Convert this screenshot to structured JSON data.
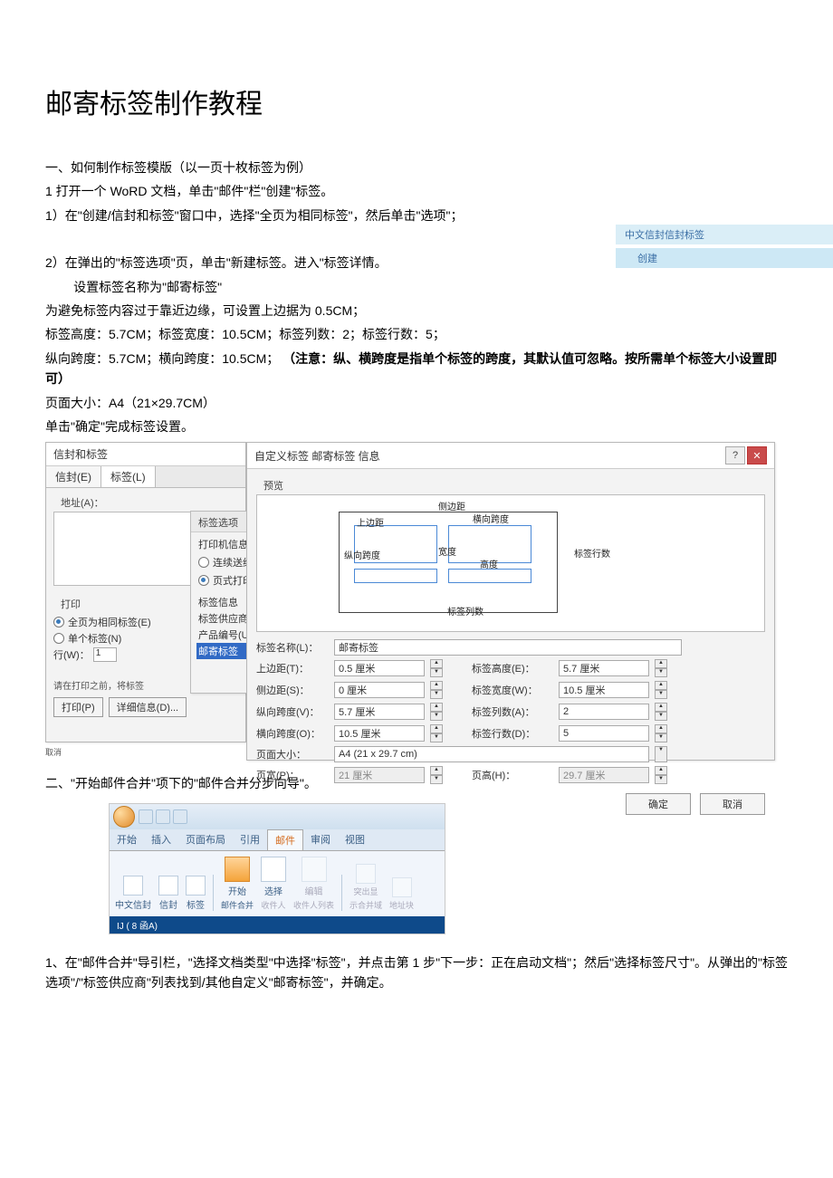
{
  "doc": {
    "title": "邮寄标签制作教程",
    "section1": "一、如何制作标签模版（以一页十枚标签为例）",
    "step1_1": "1 打开一个 WoRD 文档，单击\"邮件\"栏\"创建\"标签。",
    "step1_1a": "1）在\"创建/信封和标签\"窗口中，选择\"全页为相同标签\"，然后单击\"选项\"；",
    "step1_2": "2）在弹出的\"标签选项\"页，单击\"新建标签。进入\"标签详情。",
    "set_name": "        设置标签名称为\"邮寄标签\"",
    "avoid_edge": "为避免标签内容过于靠近边缘，可设置上边据为 0.5CM；",
    "dims1": "标签高度：5.7CM；标签宽度：10.5CM；标签列数：2；标签行数：5；",
    "dims2_a": "纵向跨度：5.7CM；横向跨度：10.5CM；",
    "dims2_b": "（注意：纵、横跨度是指单个标签的跨度，其默认值可忽略。按所需单个标签大小设置即可）",
    "page_size": "页面大小：A4（21×29.7CM）",
    "confirm": "单击\"确定\"完成标签设置。",
    "section2": "二、\"开始邮件合并\"项下的\"邮件合并分步向导\"。",
    "step2_1": "1、在\"邮件合并\"导引栏，\"选择文档类型\"中选择\"标签\"，并点击第 1 步\"下一步：正在启动文档\"；然后\"选择标签尺寸\"。从弹出的\"标签选项\"/\"标签供应商\"列表找到/其他自定义\"邮寄标签\"，并确定。"
  },
  "float": {
    "line1": "中文信封信封标签",
    "line2": "创建"
  },
  "dlg_left": {
    "title": "信封和标签",
    "tab_env": "信封(E)",
    "tab_lbl": "标签(L)",
    "address": "地址(A)：",
    "print": "打印",
    "full_page": "全页为相同标签(E)",
    "single": "单个标签(N)",
    "row": "行(W)：",
    "row_val": "1",
    "before_print": "请在打印之前，将标签",
    "btn_print": "打印(P)",
    "btn_detail": "详细信息(D)...",
    "cancel": "取消"
  },
  "dlg_mid": {
    "title": "标签选项",
    "printer_info": "打印机信息",
    "cont_feed": "连续送纸打印机",
    "page_printer": "页式打印机(A)",
    "label_info": "标签信息",
    "vendor": "标签供应商(V)：",
    "product_no": "产品编号(U)：",
    "selected": "邮寄标签"
  },
  "dlg_right": {
    "title": "自定义标签 邮寄标签 信息",
    "preview": "预览",
    "pv_sidemargin": "侧边距",
    "pv_topmargin": "上边距",
    "pv_hspan": "横向跨度",
    "pv_vspan": "纵向跨度",
    "pv_width": "宽度",
    "pv_height": "高度",
    "pv_rows": "标签行数",
    "pv_cols": "标签列数",
    "lbl_name": "标签名称(L)：",
    "val_name": "邮寄标签",
    "lbl_top": "上边距(T)：",
    "val_top": "0.5 厘米",
    "lbl_side": "侧边距(S)：",
    "val_side": "0 厘米",
    "lbl_vspan": "纵向跨度(V)：",
    "val_vspan": "5.7 厘米",
    "lbl_hspan": "横向跨度(O)：",
    "val_hspan": "10.5 厘米",
    "lbl_page": "页面大小：",
    "val_page": "A4 (21 x 29.7 cm)",
    "lbl_pwidth": "页宽(P)：",
    "val_pwidth": "21 厘米",
    "lbl_lheight": "标签高度(E)：",
    "val_lheight": "5.7 厘米",
    "lbl_lwidth": "标签宽度(W)：",
    "val_lwidth": "10.5 厘米",
    "lbl_cols": "标签列数(A)：",
    "val_cols": "2",
    "lbl_rows": "标签行数(D)：",
    "val_rows": "5",
    "lbl_pheight": "页高(H)：",
    "val_pheight": "29.7 厘米",
    "ok": "确定",
    "cancel": "取消"
  },
  "ribbon": {
    "tabs": [
      "开始",
      "插入",
      "页面布局",
      "引用",
      "邮件",
      "审阅",
      "视图"
    ],
    "env_cn": "中文信封",
    "env": "信封",
    "label": "标签",
    "start": "开始",
    "start2": "邮件合并",
    "select": "选择",
    "recipients": "收件人",
    "edit": "编辑",
    "reclist": "收件人列表",
    "highlight": "突出显",
    "highlight2": "示合并域",
    "addr": "地址块",
    "ij": "IJ  ( 8 函A)"
  }
}
